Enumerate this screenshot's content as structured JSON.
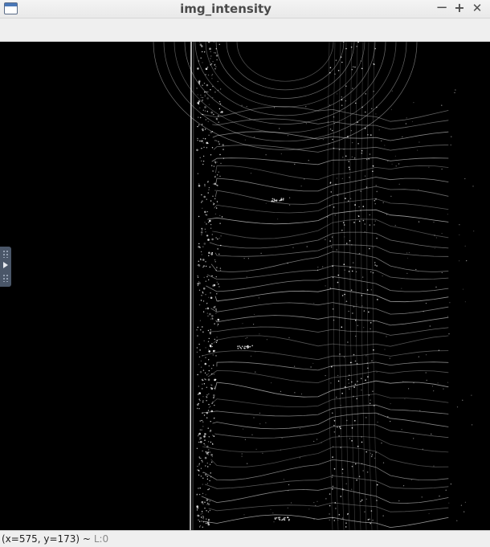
{
  "window": {
    "title": "img_intensity",
    "icon": "window-app-icon",
    "controls": {
      "minimize": "−",
      "maximize": "+",
      "close": "✕"
    }
  },
  "viewport": {
    "background": "#000000",
    "point_color": "#ffffff",
    "content": "lidar-intensity-image"
  },
  "side_panel": {
    "icon": "expand-panel-arrow-icon"
  },
  "statusbar": {
    "coords": "(x=575, y=173) ~",
    "level": "L:0"
  }
}
